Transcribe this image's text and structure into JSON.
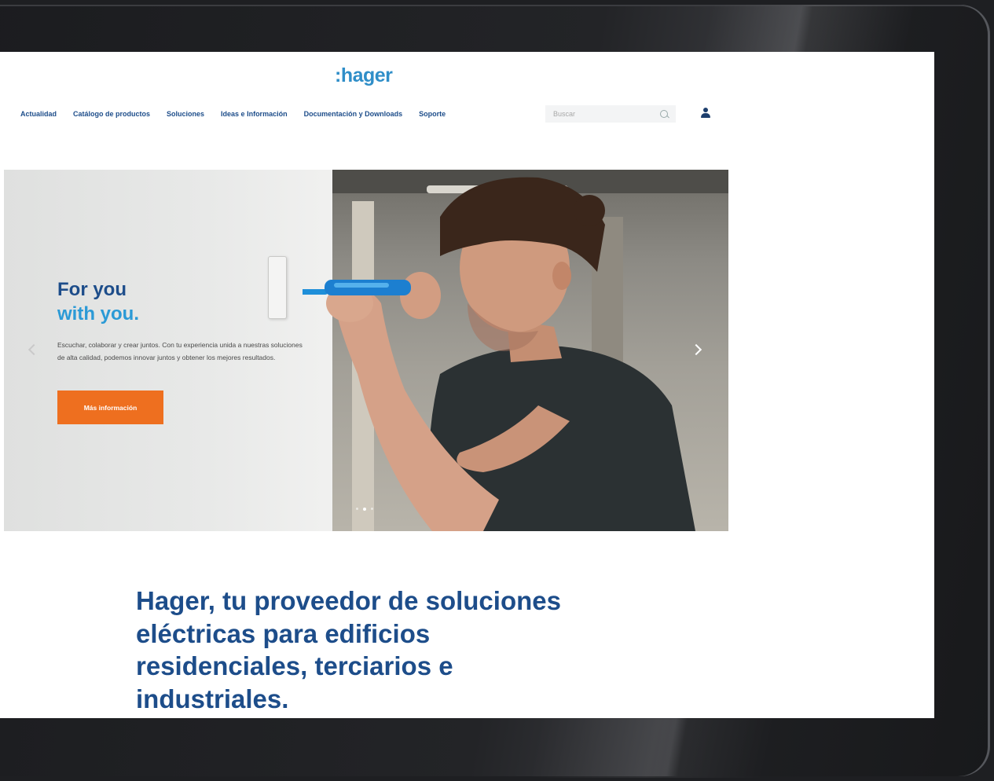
{
  "header": {
    "logo_text": ":hager",
    "nav": [
      {
        "label": "Actualidad"
      },
      {
        "label": "Catálogo de productos"
      },
      {
        "label": "Soluciones"
      },
      {
        "label": "Ideas e Información"
      },
      {
        "label": "Documentación y Downloads"
      },
      {
        "label": "Soporte"
      }
    ],
    "search": {
      "placeholder": "Buscar",
      "icon": "search-icon"
    },
    "account_icon": "user-icon"
  },
  "hero": {
    "title_line1": "For you",
    "title_line2": "with you.",
    "description": "Escuchar, colaborar y crear juntos. Con tu experiencia unida a nuestras soluciones de alta calidad, podemos innovar juntos y obtener los mejores resultados.",
    "cta_label": "Más información",
    "slides_total": 3,
    "active_slide": 2
  },
  "main": {
    "headline": "Hager, tu proveedor de soluciones eléctricas para edificios residenciales, terciarios e industriales."
  },
  "colors": {
    "brand_blue": "#1d4d8a",
    "accent_blue": "#2b9ad6",
    "cta_orange": "#ee6f1f",
    "logo_blue": "#2f8ec8"
  }
}
